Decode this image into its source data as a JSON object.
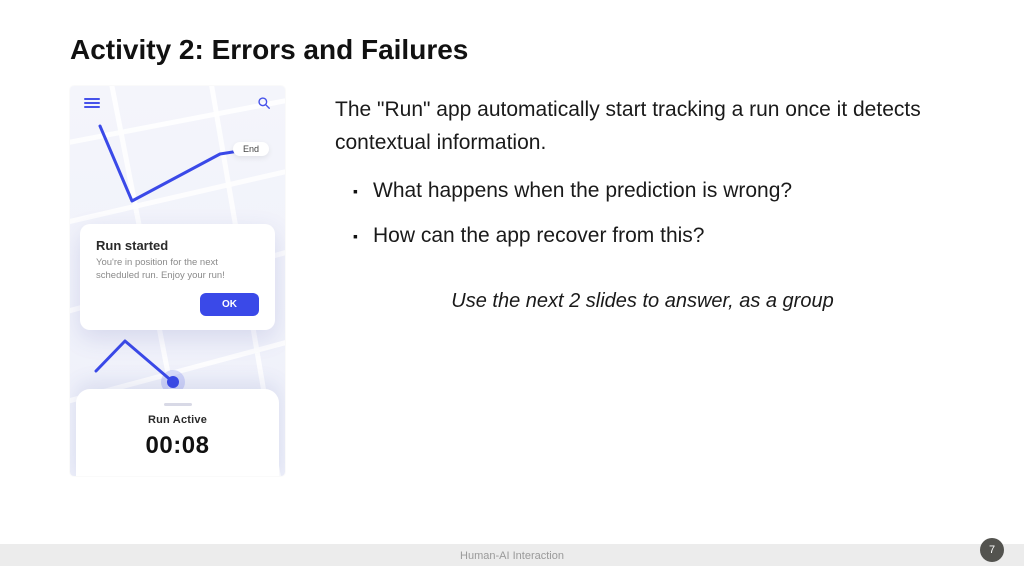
{
  "title": "Activity 2: Errors and Failures",
  "paragraph": "The \"Run\" app automatically start tracking a run once it detects contextual information.",
  "bullets": [
    "What happens when the prediction is wrong?",
    "How can the app recover from this?"
  ],
  "instruction": "Use the next 2 slides to answer, as a group",
  "footer": "Human-AI Interaction",
  "page": "7",
  "phone": {
    "end_label": "End",
    "card_title": "Run started",
    "card_body": "You're in position for the next scheduled run. Enjoy your run!",
    "ok": "OK",
    "sheet_label": "Run Active",
    "time": "00:08"
  }
}
